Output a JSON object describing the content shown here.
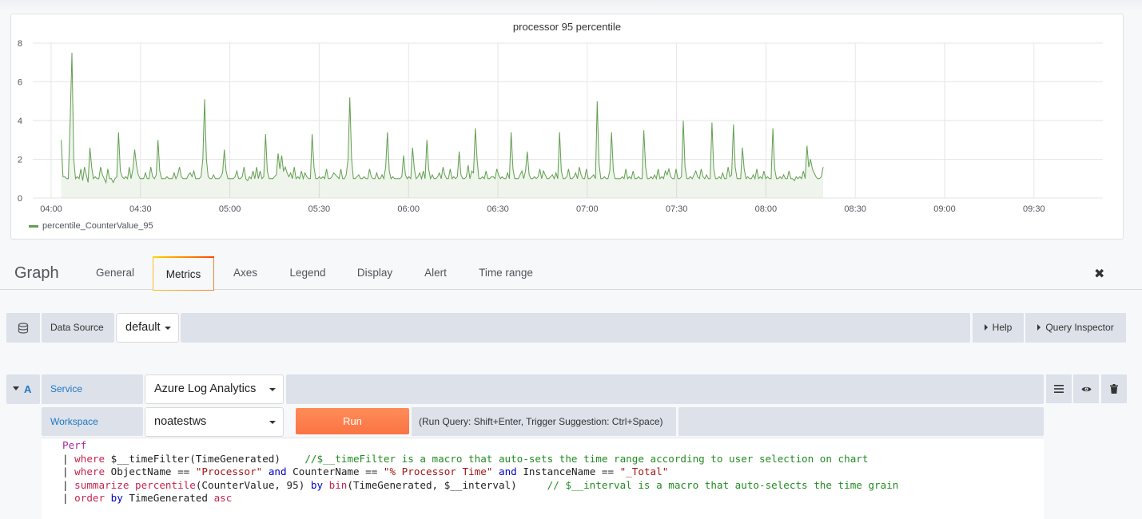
{
  "panel": {
    "title": "processor 95 percentile"
  },
  "chart_data": {
    "type": "area",
    "title": "processor 95 percentile",
    "ylim": [
      0,
      8
    ],
    "yticks": [
      0,
      2,
      4,
      6,
      8
    ],
    "xticks": [
      "04:00",
      "04:30",
      "05:00",
      "05:30",
      "06:00",
      "06:30",
      "07:00",
      "07:30",
      "08:00",
      "08:30",
      "09:00",
      "09:30"
    ],
    "xrange_minutes": [
      3.37,
      259.2
    ],
    "legend_placement": "bottom-left",
    "grid": true,
    "color": "#629e51",
    "series": [
      {
        "name": "percentile_CounterValue_95",
        "values": [
          3.0,
          1.1,
          1.1,
          1.0,
          1.0,
          4.0,
          7.5,
          2.0,
          1.0,
          1.1,
          1.0,
          1.5,
          0.9,
          1.6,
          1.2,
          0.8,
          2.6,
          1.6,
          1.0,
          1.1,
          1.0,
          1.0,
          1.6,
          1.2,
          1.0,
          0.8,
          1.5,
          1.0,
          1.0,
          0.8,
          1.0,
          1.1,
          3.4,
          1.4,
          1.1,
          1.0,
          1.1,
          1.0,
          1.6,
          1.0,
          1.5,
          2.5,
          1.7,
          1.2,
          1.0,
          1.0,
          1.0,
          1.3,
          1.0,
          1.0,
          1.6,
          1.1,
          1.0,
          1.2,
          3.0,
          1.4,
          1.0,
          1.0,
          1.0,
          1.1,
          1.0,
          1.0,
          1.0,
          1.3,
          1.0,
          1.2,
          1.6,
          1.1,
          1.0,
          1.0,
          1.0,
          1.2,
          1.3,
          1.1,
          1.4,
          1.0,
          1.0,
          1.0,
          1.1,
          2.0,
          5.1,
          2.0,
          1.1,
          1.0,
          1.0,
          1.2,
          1.0,
          1.0,
          1.0,
          1.1,
          1.3,
          2.5,
          1.4,
          1.0,
          1.0,
          1.0,
          1.0,
          1.1,
          1.4,
          1.0,
          1.0,
          1.1,
          1.6,
          1.0,
          0.9,
          1.1,
          1.0,
          1.4,
          1.0,
          1.6,
          1.0,
          1.4,
          1.0,
          1.1,
          3.3,
          1.4,
          1.0,
          1.0,
          1.0,
          1.1,
          1.2,
          2.3,
          1.5,
          2.2,
          1.4,
          1.6,
          1.3,
          1.1,
          1.3,
          1.0,
          1.6,
          1.0,
          1.1,
          1.0,
          1.4,
          1.0,
          1.3,
          1.1,
          1.0,
          1.0,
          3.3,
          1.6,
          1.0,
          1.0,
          1.1,
          1.0,
          1.1,
          1.0,
          1.5,
          1.0,
          1.0,
          1.1,
          1.3,
          1.2,
          1.1,
          1.0,
          1.5,
          1.0,
          1.0,
          1.2,
          2.0,
          5.2,
          2.0,
          1.0,
          1.0,
          1.1,
          1.2,
          1.0,
          1.0,
          1.1,
          1.0,
          1.0,
          1.5,
          1.1,
          1.0,
          1.0,
          1.3,
          1.0,
          1.0,
          1.2,
          1.0,
          1.6,
          3.4,
          1.4,
          1.0,
          1.1,
          1.0,
          1.0,
          1.0,
          1.0,
          1.1,
          2.2,
          1.2,
          1.0,
          1.1,
          1.0,
          2.6,
          1.5,
          1.0,
          1.1,
          1.3,
          1.0,
          1.4,
          1.0,
          3.0,
          1.5,
          1.0,
          1.2,
          1.0,
          1.0,
          1.1,
          1.3,
          1.0,
          1.6,
          1.2,
          1.0,
          1.0,
          1.5,
          1.0,
          1.1,
          1.0,
          1.1,
          2.4,
          1.2,
          1.0,
          1.0,
          1.1,
          1.7,
          1.0,
          1.4,
          1.3,
          3.6,
          2.0,
          1.0,
          1.0,
          1.1,
          1.0,
          1.4,
          1.0,
          1.0,
          1.1,
          1.1,
          1.0,
          1.5,
          1.2,
          1.0,
          1.1,
          1.0,
          1.0,
          1.3,
          1.0,
          3.4,
          1.5,
          1.0,
          1.0,
          1.0,
          1.2,
          1.4,
          1.0,
          1.4,
          2.4,
          1.2,
          1.0,
          1.0,
          1.1,
          1.0,
          1.1,
          1.5,
          1.0,
          1.4,
          1.2,
          1.0,
          1.0,
          1.1,
          1.2,
          1.0,
          1.3,
          1.0,
          3.4,
          1.4,
          1.0,
          1.0,
          1.1,
          1.5,
          1.0,
          1.0,
          1.1,
          1.3,
          1.0,
          1.6,
          1.2,
          1.0,
          1.0,
          1.5,
          1.0,
          1.0,
          1.1,
          1.2,
          1.0,
          5.0,
          1.8,
          1.0,
          1.0,
          1.1,
          1.0,
          1.0,
          1.4,
          3.4,
          1.4,
          1.0,
          1.0,
          1.0,
          1.0,
          1.1,
          1.0,
          1.5,
          1.0,
          1.1,
          1.0,
          1.4,
          1.0,
          1.0,
          1.1,
          1.0,
          1.0,
          3.5,
          1.6,
          1.0,
          1.0,
          1.1,
          1.0,
          1.2,
          1.0,
          1.5,
          1.0,
          1.1,
          1.0,
          1.4,
          1.2,
          1.5,
          1.1,
          1.0,
          1.0,
          1.5,
          1.0,
          1.0,
          1.1,
          4.0,
          1.6,
          1.0,
          1.0,
          1.1,
          1.0,
          1.2,
          1.4,
          1.1,
          1.0,
          1.5,
          1.1,
          1.0,
          1.2,
          1.0,
          1.0,
          3.9,
          1.5,
          1.0,
          1.0,
          1.1,
          1.0,
          1.3,
          1.0,
          1.0,
          1.6,
          1.1,
          1.2,
          3.8,
          1.6,
          1.0,
          1.0,
          1.0,
          2.6,
          1.5,
          1.0,
          1.1,
          1.0,
          1.0,
          1.2,
          1.0,
          1.5,
          1.0,
          1.1,
          1.0,
          1.4,
          1.0,
          1.1,
          1.0,
          1.0,
          3.6,
          1.5,
          1.0,
          1.0,
          1.1,
          1.0,
          1.2,
          1.0,
          1.0,
          1.4,
          1.0,
          1.0,
          0.9,
          1.1,
          1.0,
          1.1,
          1.0,
          1.4,
          1.0,
          2.7,
          1.6,
          2.0,
          1.5,
          1.3,
          1.1,
          1.0,
          1.0,
          1.1,
          1.6
        ]
      }
    ]
  },
  "editor": {
    "title": "Graph",
    "tabs": [
      "General",
      "Metrics",
      "Axes",
      "Legend",
      "Display",
      "Alert",
      "Time range"
    ],
    "active_tab": "Metrics"
  },
  "datasource": {
    "label": "Data Source",
    "value": "default",
    "help": "Help",
    "inspector": "Query Inspector"
  },
  "query": {
    "ref_id": "A",
    "service_label": "Service",
    "service_value": "Azure Log Analytics",
    "workspace_label": "Workspace",
    "workspace_value": "noatestws",
    "run_label": "Run",
    "hint": "(Run Query: Shift+Enter, Trigger Suggestion: Ctrl+Space)"
  },
  "code_lines": [
    {
      "parts": [
        [
          "kw2",
          "Perf"
        ]
      ]
    },
    {
      "parts": [
        [
          "ref",
          "| "
        ],
        [
          "kw",
          "where "
        ],
        [
          "ref",
          "$__timeFilter(TimeGenerated)    "
        ],
        [
          "cm",
          "//$__timeFilter is a macro that auto-sets the time range according to user selection on chart"
        ]
      ]
    },
    {
      "parts": [
        [
          "ref",
          "| "
        ],
        [
          "kw",
          "where "
        ],
        [
          "ref",
          "ObjectName == "
        ],
        [
          "str",
          "\"Processor\""
        ],
        [
          "ref",
          " "
        ],
        [
          "blue",
          "and"
        ],
        [
          "ref",
          " CounterName == "
        ],
        [
          "str",
          "\"% Processor Time\""
        ],
        [
          "ref",
          " "
        ],
        [
          "blue",
          "and"
        ],
        [
          "ref",
          " InstanceName == "
        ],
        [
          "str",
          "\"_Total\""
        ]
      ]
    },
    {
      "parts": [
        [
          "ref",
          "| "
        ],
        [
          "kw",
          "summarize "
        ],
        [
          "fn",
          "percentile"
        ],
        [
          "ref",
          "(CounterValue, 95) "
        ],
        [
          "blue",
          "by "
        ],
        [
          "fn",
          "bin"
        ],
        [
          "ref",
          "(TimeGenerated, $__interval)     "
        ],
        [
          "cm",
          "// $__interval is a macro that auto-selects the time grain"
        ]
      ]
    },
    {
      "parts": [
        [
          "ref",
          "| "
        ],
        [
          "kw",
          "order "
        ],
        [
          "blue",
          "by "
        ],
        [
          "ref",
          "TimeGenerated "
        ],
        [
          "kw",
          "asc"
        ]
      ]
    }
  ]
}
